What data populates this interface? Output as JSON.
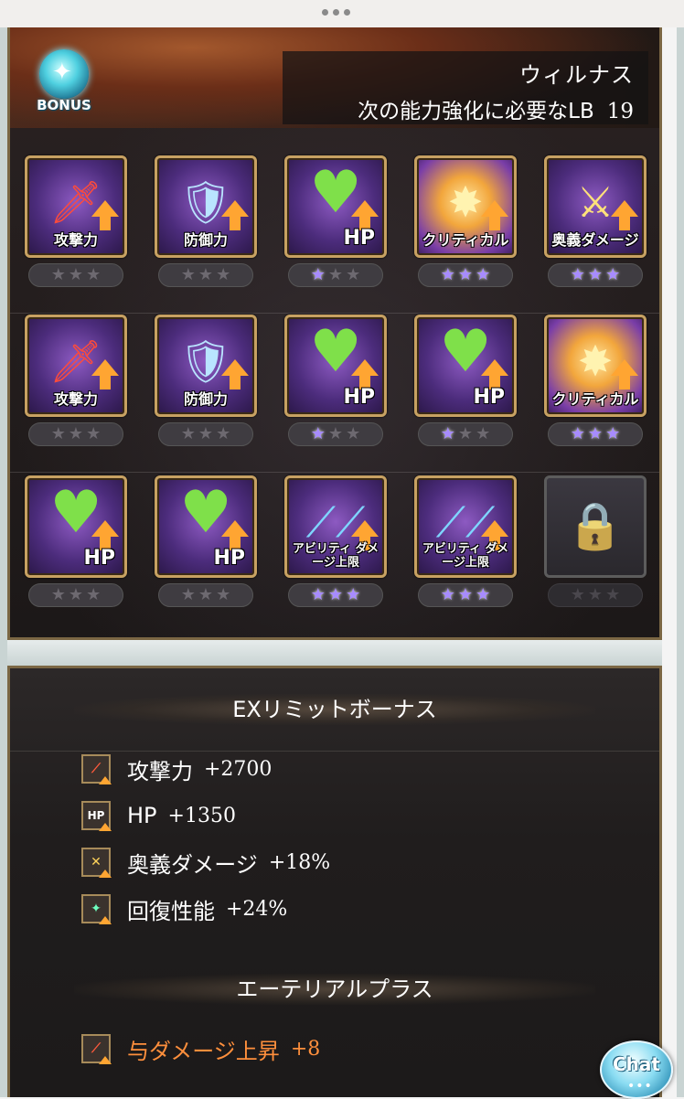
{
  "header": {
    "name": "ウィルナス",
    "lb_label": "次の能力強化に必要なLB",
    "lb_value": "19",
    "bonus_label": "BONUS"
  },
  "grid": {
    "rows": [
      [
        {
          "label": "攻撃力",
          "icon": "sword-icon",
          "stars": 0
        },
        {
          "label": "防御力",
          "icon": "shield-icon",
          "stars": 0
        },
        {
          "label": "HP",
          "icon": "heart-icon",
          "stars": 1
        },
        {
          "label": "クリティカル",
          "icon": "critical-burst-icon",
          "stars": 3
        },
        {
          "label": "奥義ダメージ",
          "icon": "crossed-swords-icon",
          "stars": 3
        }
      ],
      [
        {
          "label": "攻撃力",
          "icon": "sword-icon",
          "stars": 0
        },
        {
          "label": "防御力",
          "icon": "shield-icon",
          "stars": 0
        },
        {
          "label": "HP",
          "icon": "heart-icon",
          "stars": 1
        },
        {
          "label": "HP",
          "icon": "heart-icon",
          "stars": 1
        },
        {
          "label": "クリティカル",
          "icon": "critical-burst-icon",
          "stars": 3
        }
      ],
      [
        {
          "label": "HP",
          "icon": "heart-icon",
          "stars": 0
        },
        {
          "label": "HP",
          "icon": "heart-icon",
          "stars": 0
        },
        {
          "label": "アビリティ ダメージ上限",
          "icon": "ability-blades-icon",
          "stars": 3
        },
        {
          "label": "アビリティ ダメージ上限",
          "icon": "ability-blades-icon",
          "stars": 3
        },
        {
          "label": "",
          "icon": "lock-icon",
          "stars": 0,
          "locked": true
        }
      ]
    ]
  },
  "ex_limit": {
    "title": "EXリミットボーナス",
    "stats": [
      {
        "name": "攻撃力",
        "value": "+2700",
        "icon": "attack-up-icon"
      },
      {
        "name": "HP",
        "value": "+1350",
        "icon": "hp-up-icon",
        "icon_text": "HP"
      },
      {
        "name": "奥義ダメージ",
        "value": "+18%",
        "icon": "ougi-damage-icon"
      },
      {
        "name": "回復性能",
        "value": "+24%",
        "icon": "heal-up-icon"
      }
    ]
  },
  "ethereal": {
    "title": "エーテリアルプラス",
    "stats": [
      {
        "name": "与ダメージ上昇",
        "value": "+8",
        "icon": "damage-up-icon"
      }
    ]
  },
  "chat": {
    "label": "Chat",
    "dots": "•••"
  },
  "colors": {
    "accent_gold": "#c7a162",
    "star_on": "#a78bff",
    "ethereal_orange": "#ff8f3c",
    "arrow_orange": "#ffa532"
  }
}
